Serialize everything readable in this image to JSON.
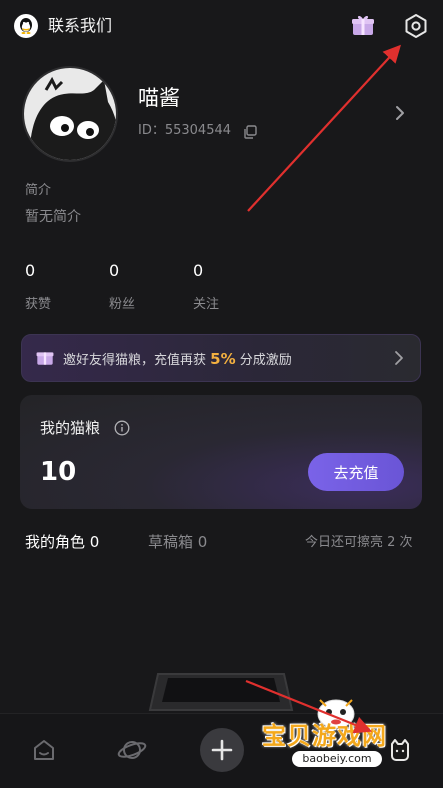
{
  "header": {
    "title": "联系我们",
    "qq_icon": "qq-icon",
    "gift_icon": "gift-icon",
    "settings_icon": "gear-icon"
  },
  "profile": {
    "nickname": "喵酱",
    "id_text": "ID：55304544",
    "bio_label": "简介",
    "bio_text": "暂无简介",
    "stats": [
      {
        "value": "0",
        "label": "获赞"
      },
      {
        "value": "0",
        "label": "粉丝"
      },
      {
        "value": "0",
        "label": "关注"
      }
    ]
  },
  "invite_banner": {
    "text_before": "邀好友得猫粮，充值再获 ",
    "highlight": "5%",
    "text_after": " 分成激励"
  },
  "wallet": {
    "title": "我的猫粮",
    "balance": "10",
    "recharge_label": "去充值"
  },
  "tabs": {
    "roles": "我的角色 0",
    "drafts": "草稿箱 0",
    "daily_hint": "今日还可擦亮 2 次"
  },
  "watermark": {
    "logo": "宝贝游戏网",
    "url": "baobeiy.com"
  },
  "colors": {
    "accent": "#7060e0",
    "highlight": "#f3b040",
    "background": "#18181a",
    "annotation_arrow": "#e0302e"
  }
}
